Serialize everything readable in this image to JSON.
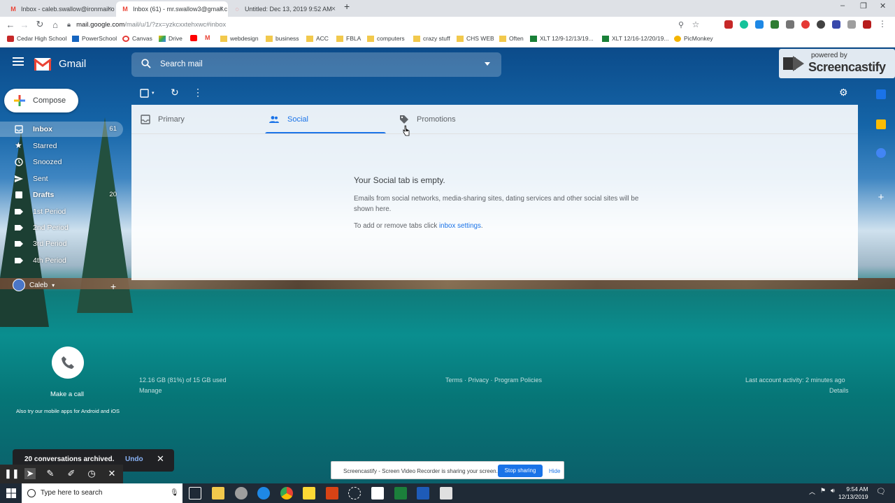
{
  "browser": {
    "tabs": [
      {
        "title": "Inbox - caleb.swallow@ironmail.o",
        "favicon": "gmail-icon"
      },
      {
        "title": "Inbox (61) - mr.swallow3@gmail.c",
        "favicon": "gmail-icon"
      },
      {
        "title": "Untitled: Dec 13, 2019 9:52 AM",
        "favicon": "screencastify-icon"
      }
    ],
    "url_host": "mail.google.com",
    "url_path": "/mail/u/1/?zx=yzkcxxtehxwc#inbox",
    "bookmarks": [
      "Cedar High School",
      "PowerSchool",
      "Canvas",
      "Drive",
      "",
      "",
      "webdesign",
      "business",
      "ACC",
      "FBLA",
      "computers",
      "crazy stuff",
      "CHS WEB",
      "Often",
      "XLT 12/9-12/13/19...",
      "XLT 12/16-12/20/19...",
      "PicMonkey"
    ]
  },
  "gmail": {
    "app_name": "Gmail",
    "search_placeholder": "Search mail",
    "compose_label": "Compose",
    "sidebar": [
      {
        "label": "Inbox",
        "count": "61",
        "icon": "inbox-icon",
        "active": true,
        "bold": true
      },
      {
        "label": "Starred",
        "count": "",
        "icon": "star-icon",
        "active": false,
        "bold": false
      },
      {
        "label": "Snoozed",
        "count": "",
        "icon": "clock-icon",
        "active": false,
        "bold": false
      },
      {
        "label": "Sent",
        "count": "",
        "icon": "send-icon",
        "active": false,
        "bold": false
      },
      {
        "label": "Drafts",
        "count": "20",
        "icon": "draft-icon",
        "active": false,
        "bold": true
      },
      {
        "label": "1st Period",
        "count": "",
        "icon": "label-icon",
        "active": false,
        "bold": false
      },
      {
        "label": "2nd Period",
        "count": "",
        "icon": "label-icon",
        "active": false,
        "bold": false
      },
      {
        "label": "3rd Period",
        "count": "",
        "icon": "label-icon",
        "active": false,
        "bold": false
      },
      {
        "label": "4th Period",
        "count": "",
        "icon": "label-icon",
        "active": false,
        "bold": false
      }
    ],
    "hangouts_user": "Caleb",
    "category_tabs": [
      {
        "label": "Primary",
        "icon": "inbox-tab-icon",
        "selected": false
      },
      {
        "label": "Social",
        "icon": "people-icon",
        "selected": true
      },
      {
        "label": "Promotions",
        "icon": "tag-icon",
        "selected": false
      }
    ],
    "empty_title": "Your Social tab is empty.",
    "empty_desc": "Emails from social networks, media-sharing sites, dating services and other social sites will be shown here.",
    "empty_tabs_prefix": "To add or remove tabs click ",
    "empty_tabs_link": "inbox settings",
    "empty_tabs_suffix": ".",
    "storage": "12.16 GB (81%) of 15 GB used",
    "manage": "Manage",
    "footer_links": "Terms · Privacy · Program Policies",
    "last_activity": "Last account activity: 2 minutes ago",
    "details": "Details",
    "make_call": "Make a call",
    "mobile_apps": "Also try our mobile apps for Android and iOS",
    "toast_msg": "20 conversations archived.",
    "toast_undo": "Undo"
  },
  "watermark": {
    "top": "powered by",
    "brand": "Screencastify"
  },
  "share_bar": {
    "text": "Screencastify - Screen Video Recorder is sharing your screen.",
    "stop": "Stop sharing",
    "hide": "Hide"
  },
  "taskbar": {
    "search_placeholder": "Type here to search",
    "time": "9:54 AM",
    "date": "12/13/2019"
  },
  "colors": {
    "accent": "#1a73e8",
    "gmail_red": "#ea4335"
  }
}
